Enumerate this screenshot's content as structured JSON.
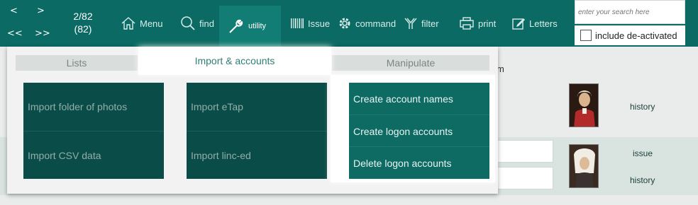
{
  "nav": {
    "prev": "<",
    "next": ">",
    "first": "<<",
    "last": ">>",
    "position": "2/82",
    "total": "(82)"
  },
  "toolbar": {
    "items": [
      {
        "label": "Menu",
        "icon": "home-icon"
      },
      {
        "label": "find",
        "icon": "magnifier-icon"
      },
      {
        "label": "utility",
        "icon": "wrench-icon",
        "active": true
      },
      {
        "label": "Issue",
        "icon": "barcode-icon"
      },
      {
        "label": "command",
        "icon": "gear-icon"
      },
      {
        "label": "filter",
        "icon": "filter-icon"
      },
      {
        "label": "print",
        "icon": "printer-icon"
      },
      {
        "label": "Letters",
        "icon": "edit-icon"
      }
    ]
  },
  "search": {
    "placeholder": "enter your search here",
    "deactivated_label": "include de-activated",
    "deactivated_checked": false
  },
  "menu": {
    "headers": [
      "Lists",
      "Import & accounts",
      "Manipulate"
    ],
    "active_header": "Import & accounts",
    "columns": [
      {
        "items": [
          "Import folder of photos",
          "Import CSV data"
        ]
      },
      {
        "items": [
          "Import eTap",
          "Import linc-ed"
        ]
      },
      {
        "items": [
          "Create account names",
          "Create logon accounts",
          "Delete logon accounts"
        ]
      }
    ]
  },
  "background": {
    "partial_letter": "m",
    "row1_link": "history",
    "row2_links": [
      "issue",
      "history"
    ]
  },
  "colors": {
    "toolbar_bg": "#0b6a63",
    "tile_dark": "#0a4c47",
    "tile_highlight": "#0d6b63",
    "active_header_text": "#2e7e76"
  }
}
